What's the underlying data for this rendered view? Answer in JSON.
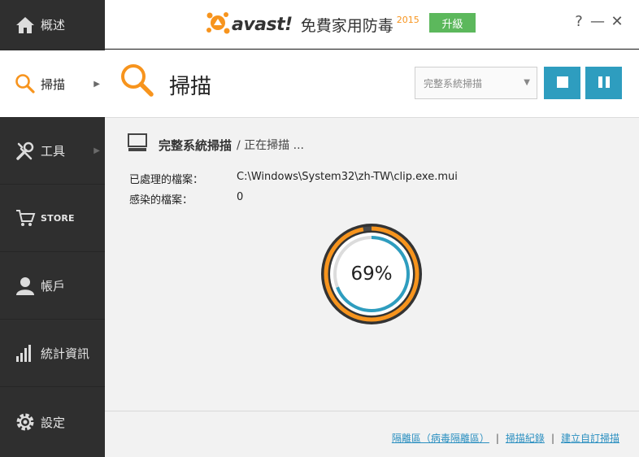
{
  "sidebar": {
    "items": [
      {
        "label": "概述",
        "icon": "home-icon"
      },
      {
        "label": "掃描",
        "icon": "magnifier-icon"
      },
      {
        "label": "工具",
        "icon": "tools-icon"
      },
      {
        "label": "STORE",
        "icon": "cart-icon"
      },
      {
        "label": "帳戶",
        "icon": "user-icon"
      },
      {
        "label": "統計資訊",
        "icon": "stats-icon"
      },
      {
        "label": "設定",
        "icon": "gear-icon"
      }
    ]
  },
  "topbar": {
    "brand": "avast!",
    "title": "免費家用防毒",
    "year": "2015",
    "upgrade_label": "升級",
    "help": "?",
    "minimize": "—",
    "close": "✕"
  },
  "header": {
    "title": "掃描",
    "scan_select": {
      "selected": "完整系統掃描"
    }
  },
  "scan": {
    "name": "完整系統掃描",
    "status": "/ 正在掃描 ...",
    "processed_label": "已處理的檔案：",
    "processed_value": "C:\\Windows\\System32\\zh-TW\\clip.exe.mui",
    "infected_label": "感染的檔案：",
    "infected_value": "0",
    "progress_text": "69%",
    "progress": 0.69
  },
  "footer": {
    "links": [
      "隔離區（病毒隔離區）",
      "掃描紀錄",
      "建立自訂掃描"
    ],
    "separator": "|"
  },
  "colors": {
    "accent_orange": "#f7941d",
    "accent_blue": "#2e9dbf",
    "upgrade_green": "#5cb85c",
    "sidebar_bg": "#2f2f2f"
  }
}
